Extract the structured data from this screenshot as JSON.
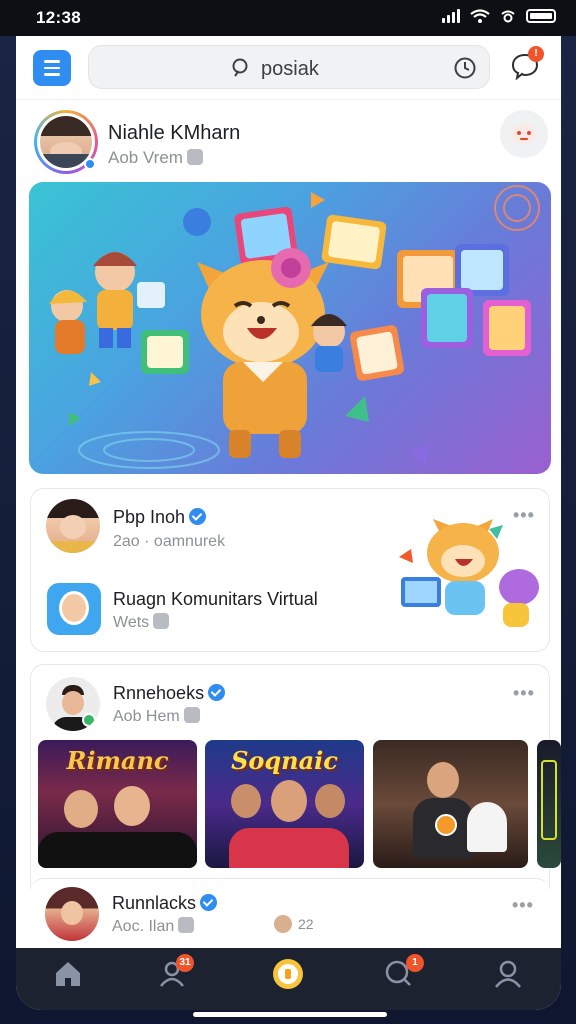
{
  "status": {
    "time": "12:38"
  },
  "search": {
    "query": "posiak"
  },
  "profile": {
    "name": "Niahle KMharn",
    "sub": "Aob Vrem"
  },
  "card1": {
    "row1": {
      "name": "Pbp Inoh",
      "sub": "2ao · oamnurek"
    },
    "row2": {
      "name": "Ruagn Komunitars Virtual",
      "sub": "Wets"
    },
    "more": "•••"
  },
  "card2": {
    "name": "Rnnehoeks",
    "sub": "Aob Hem",
    "more": "•••",
    "thumbs": [
      {
        "title": "Rimanc"
      },
      {
        "title": "Soqnaic"
      },
      {
        "title": ""
      }
    ]
  },
  "card3": {
    "name": "Runnlacks",
    "sub": "Aoc. Ilan",
    "count": "22",
    "more": "•••"
  },
  "nav": {
    "badge_people": "31",
    "badge_search": "1"
  },
  "colors": {
    "accent": "#2f8cf0",
    "badge": "#f0542b",
    "nav_bg": "#1c2230"
  },
  "icons": [
    "menu-icon",
    "search-icon",
    "history-icon",
    "chat-icon",
    "home-icon",
    "people-icon",
    "record-icon",
    "search-nav-icon",
    "profile-icon"
  ]
}
